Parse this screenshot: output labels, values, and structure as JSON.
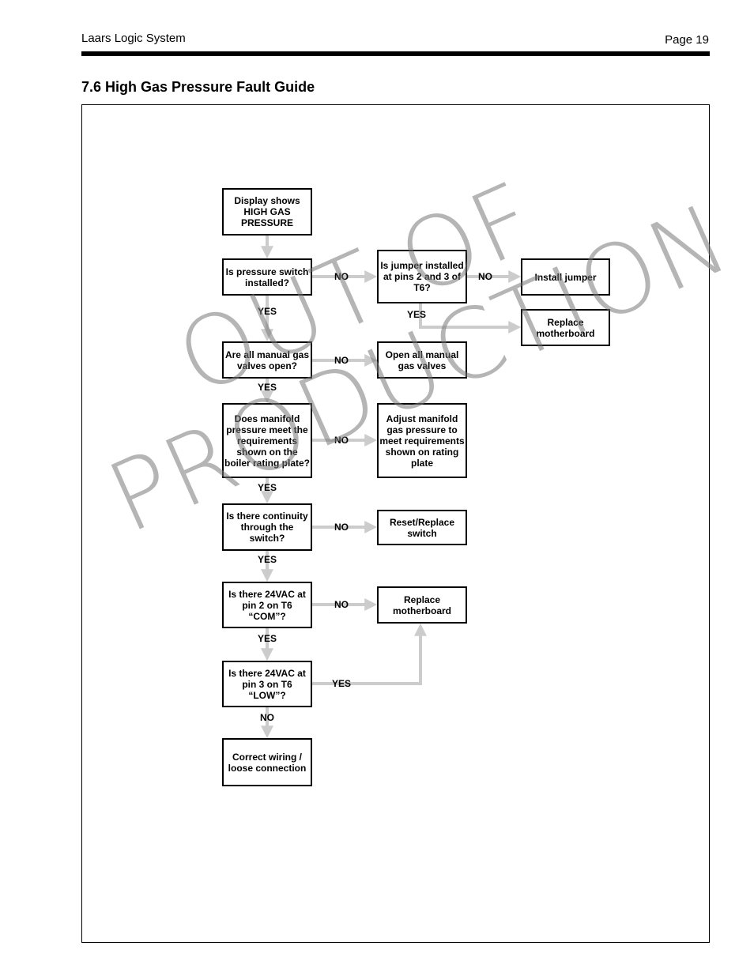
{
  "header": {
    "left": "Laars Logic System",
    "right": "Page 19"
  },
  "section_title": "7.6  High Gas Pressure Fault Guide",
  "flowchart": {
    "boxes": {
      "start": "Display shows HIGH GAS PRESSURE",
      "q_pressure_switch": "Is pressure switch installed?",
      "q_jumper": "Is jumper installed at pins 2 and 3 of T6?",
      "a_install_jumper": "Install jumper",
      "a_replace_motherboard_1": "Replace motherboard",
      "q_gas_valves": "Are all manual gas valves open?",
      "a_open_valves": "Open all manual gas valves",
      "q_manifold": "Does manifold pressure meet the requirements shown on the boiler rating plate?",
      "a_adjust_manifold": "Adjust manifold gas pressure to meet requirements shown on rating plate",
      "q_continuity": "Is there continuity through the switch?",
      "a_reset_switch": "Reset/Replace switch",
      "q_24vac_com": "Is there 24VAC at pin 2 on T6 “COM”?",
      "a_replace_motherboard_2": "Replace motherboard",
      "q_24vac_low": "Is there 24VAC at pin 3 on T6 “LOW”?",
      "a_correct_wiring": "Correct wiring / loose connection"
    },
    "labels": {
      "yes": "YES",
      "no": "NO"
    }
  },
  "watermark": {
    "line1": "OUT OF",
    "line2": "PRODUCTION"
  },
  "colors": {
    "arrow": "#cccccc",
    "watermark": "#8c8c8c"
  }
}
